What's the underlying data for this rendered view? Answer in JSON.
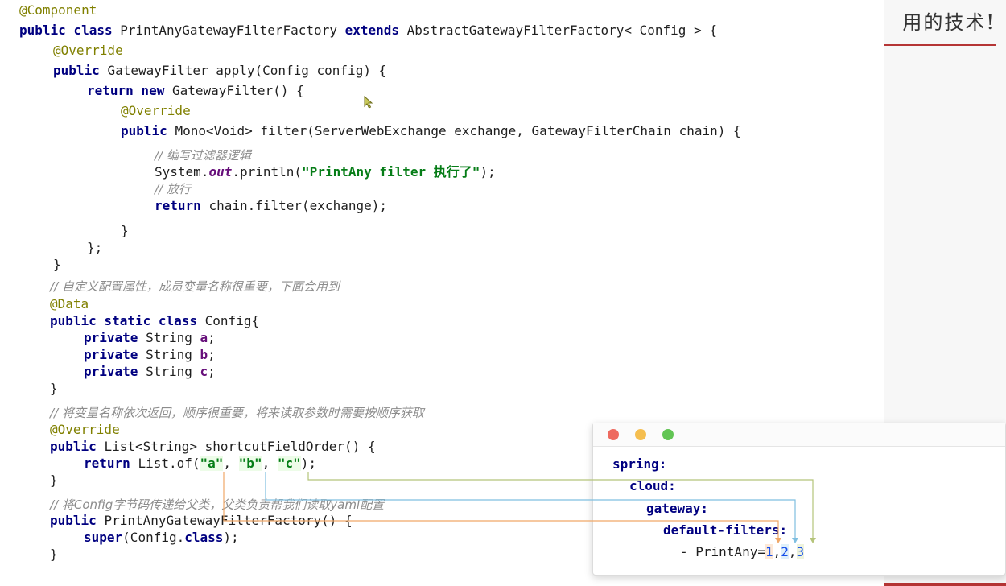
{
  "slide": {
    "title_fragment": "用的技术!"
  },
  "code": {
    "l01": "@Component",
    "l02_kw1": "public class ",
    "l02_t1": "PrintAnyGatewayFilterFactory ",
    "l02_kw2": "extends ",
    "l02_t2": "AbstractGatewayFilterFactory< Config > {",
    "l03": "@Override",
    "l04_kw": "public ",
    "l04_t": "GatewayFilter apply(Config config) {",
    "l05_kw": "return new ",
    "l05_t": "GatewayFilter() {",
    "l06": "@Override",
    "l07_kw": "public ",
    "l07_t": "Mono<Void> filter(ServerWebExchange exchange, GatewayFilterChain chain) {",
    "l08": "// 编写过滤器逻辑",
    "l09_a": "System.",
    "l09_out": "out",
    "l09_b": ".println(",
    "l09_str": "\"PrintAny filter 执行了\"",
    "l09_c": ");",
    "l10": "// 放行",
    "l11_kw": "return ",
    "l11_t": "chain.filter(exchange);",
    "l12": "}",
    "l13": "};",
    "l14": "}",
    "l15": "// 自定义配置属性，成员变量名称很重要，下面会用到",
    "l16": "@Data",
    "l17_kw": "public static class ",
    "l17_t": "Config{",
    "l18_kw": "private ",
    "l18_t": "String ",
    "l18_f": "a",
    "l19_kw": "private ",
    "l19_t": "String ",
    "l19_f": "b",
    "l20_kw": "private ",
    "l20_t": "String ",
    "l20_f": "c",
    "l21": "}",
    "l22": "// 将变量名称依次返回，顺序很重要，将来读取参数时需要按顺序获取",
    "l23": "@Override",
    "l24_kw": "public ",
    "l24_t": "List<String> shortcutFieldOrder() {",
    "l25_kw": "return ",
    "l25_t": "List.of(",
    "l25_a": "\"a\"",
    "l25_b": "\"b\"",
    "l25_c": "\"c\"",
    "l26": "}",
    "l27": "// 将Config字节码传递给父类，父类负责帮我们读取yaml配置",
    "l28_kw": "public ",
    "l28_t": "PrintAnyGatewayFilterFactory() {",
    "l29_kw": "super",
    "l29_t": "(Config.",
    "l29_kw2": "class",
    "l29_t2": ");",
    "l30": "}"
  },
  "yaml": {
    "spring": "spring:",
    "cloud": "cloud:",
    "gateway": "gateway:",
    "default_filters": "default-filters:",
    "item_prefix": "- PrintAny=",
    "v1": "1",
    "v2": "2",
    "v3": "3"
  },
  "colors": {
    "connector_a": "#f0a868",
    "connector_b": "#7fbfe0",
    "connector_c": "#b5c47a",
    "accent_rule": "#b53535"
  }
}
